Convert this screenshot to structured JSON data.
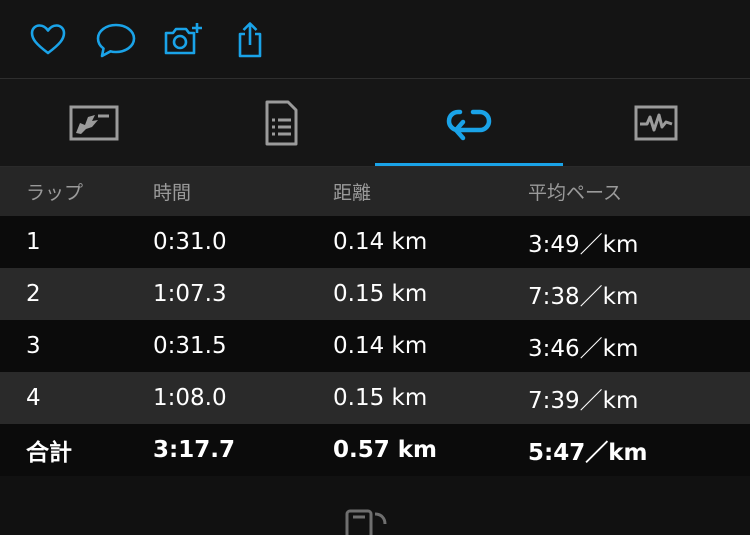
{
  "actions": [
    {
      "icon": "heart-icon"
    },
    {
      "icon": "comment-icon"
    },
    {
      "icon": "add-photo-icon"
    },
    {
      "icon": "share-icon"
    }
  ],
  "tabs": [
    {
      "icon": "map-icon",
      "active": false
    },
    {
      "icon": "details-icon",
      "active": false
    },
    {
      "icon": "laps-icon",
      "active": true
    },
    {
      "icon": "chart-icon",
      "active": false
    }
  ],
  "colors": {
    "accent": "#1aa3e8",
    "icon_inactive": "#9b9b9b"
  },
  "laps_table": {
    "headers": {
      "lap": "ラップ",
      "time": "時間",
      "distance": "距離",
      "pace": "平均ペース"
    },
    "rows": [
      {
        "lap": "1",
        "time": "0:31.0",
        "distance": "0.14 km",
        "pace": "3:49／km"
      },
      {
        "lap": "2",
        "time": "1:07.3",
        "distance": "0.15 km",
        "pace": "7:38／km"
      },
      {
        "lap": "3",
        "time": "0:31.5",
        "distance": "0.14 km",
        "pace": "3:46／km"
      },
      {
        "lap": "4",
        "time": "1:08.0",
        "distance": "0.15 km",
        "pace": "7:39／km"
      }
    ],
    "total": {
      "lap": "合計",
      "time": "3:17.7",
      "distance": "0.57 km",
      "pace": "5:47／km"
    }
  }
}
